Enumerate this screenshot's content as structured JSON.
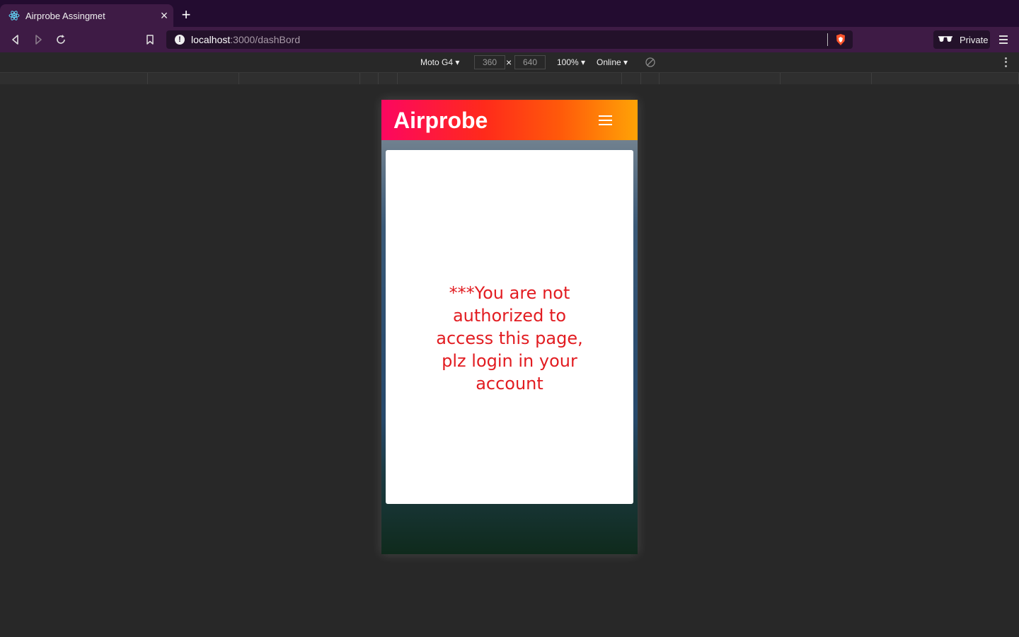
{
  "browser": {
    "tab": {
      "title": "Airprobe Assingmet",
      "favicon": "react-atom-icon"
    },
    "url": {
      "host": "localhost",
      "path": ":3000/dashBord"
    },
    "private_label": "Private",
    "colors": {
      "tabstrip": "#230c30",
      "toolbar": "#3e1b45",
      "urlbar": "#23112a"
    }
  },
  "device_toolbar": {
    "device": "Moto G4",
    "width": "360",
    "height": "640",
    "zoom": "100%",
    "network": "Online"
  },
  "app": {
    "brand": "Airprobe",
    "message": "***You are not authorized to access this page, plz login in your account",
    "colors": {
      "header_start": "#fc0760",
      "header_end": "#ffa306",
      "warning_text": "#e21c21"
    }
  }
}
